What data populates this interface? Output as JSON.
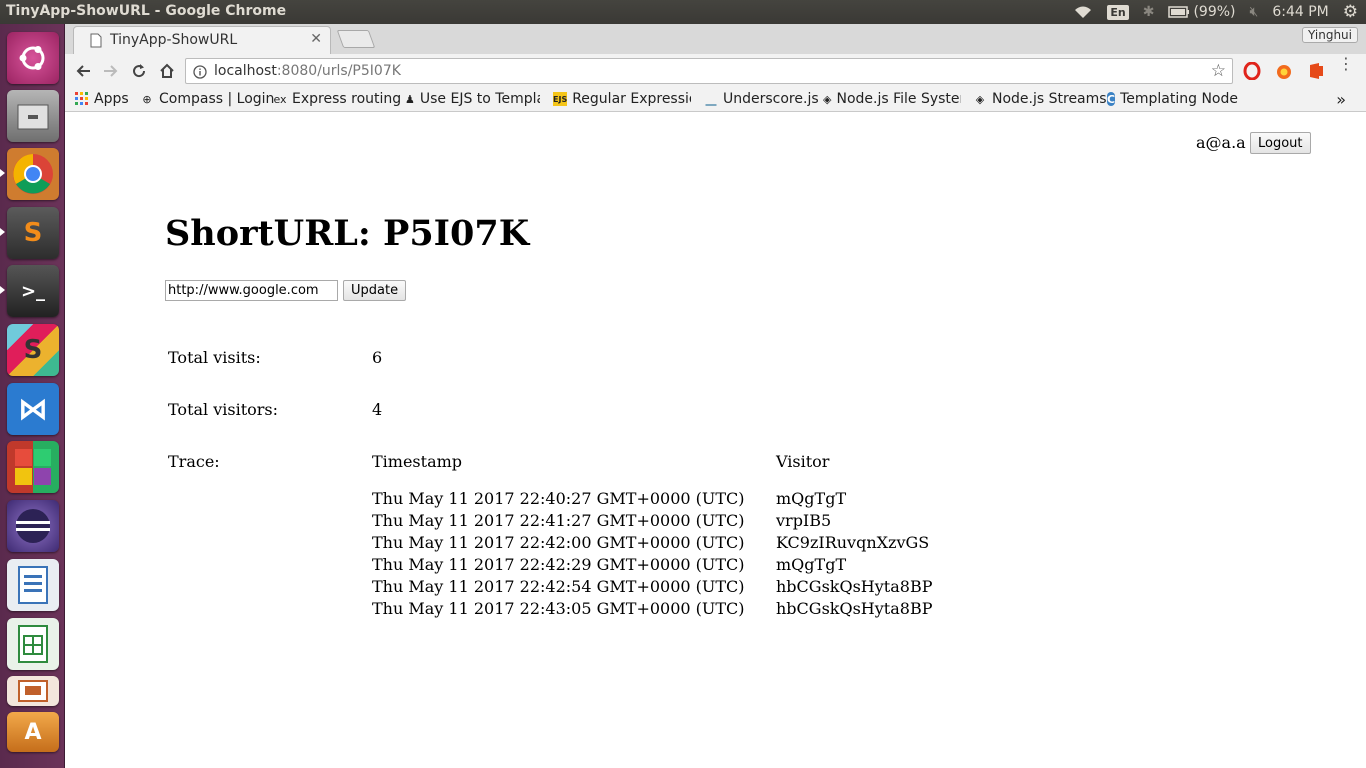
{
  "os": {
    "window_title": "TinyApp-ShowURL - Google Chrome",
    "keyboard": "En",
    "battery": "(99%)",
    "clock": "6:44 PM"
  },
  "browser": {
    "tab_title": "TinyApp-ShowURL",
    "profile": "Yinghui",
    "url_host": "localhost",
    "url_rest": ":8080/urls/P5I07K",
    "bookmarks": [
      {
        "label": "Apps",
        "icon": "apps-grid-icon"
      },
      {
        "label": "Compass | Login",
        "icon": "compass-icon"
      },
      {
        "label": "Express routing",
        "icon": "express-icon"
      },
      {
        "label": "Use EJS to Templa",
        "icon": "ejs-person-icon"
      },
      {
        "label": "Regular Expression",
        "icon": "ejs-icon"
      },
      {
        "label": "Underscore.js",
        "icon": "underscore-icon"
      },
      {
        "label": "Node.js File Syster",
        "icon": "nodejs-icon"
      },
      {
        "label": "Node.js Streams",
        "icon": "nodejs-icon"
      },
      {
        "label": "Templating Node a",
        "icon": "c-logo-icon"
      }
    ]
  },
  "page": {
    "user_email": "a@a.a",
    "logout_label": "Logout",
    "heading": "ShortURL: P5I07K",
    "long_url_value": "http://www.google.com",
    "update_label": "Update",
    "total_visits_label": "Total visits:",
    "total_visits": "6",
    "total_visitors_label": "Total visitors:",
    "total_visitors": "4",
    "trace_label": "Trace:",
    "timestamp_header": "Timestamp",
    "visitor_header": "Visitor",
    "trace": [
      {
        "timestamp": "Thu May 11 2017 22:40:27 GMT+0000 (UTC)",
        "visitor": "mQgTgT"
      },
      {
        "timestamp": "Thu May 11 2017 22:41:27 GMT+0000 (UTC)",
        "visitor": "vrpIB5"
      },
      {
        "timestamp": "Thu May 11 2017 22:42:00 GMT+0000 (UTC)",
        "visitor": "KC9zIRuvqnXzvGS"
      },
      {
        "timestamp": "Thu May 11 2017 22:42:29 GMT+0000 (UTC)",
        "visitor": "mQgTgT"
      },
      {
        "timestamp": "Thu May 11 2017 22:42:54 GMT+0000 (UTC)",
        "visitor": "hbCGskQsHyta8BP"
      },
      {
        "timestamp": "Thu May 11 2017 22:43:05 GMT+0000 (UTC)",
        "visitor": "hbCGskQsHyta8BP"
      }
    ]
  },
  "launcher": [
    {
      "name": "ubuntu-dash-icon",
      "color": "#b8367a"
    },
    {
      "name": "files-icon",
      "color": "#8c8c8c"
    },
    {
      "name": "chrome-icon",
      "color": "#dd4b39"
    },
    {
      "name": "sublime-text-icon",
      "color": "#4b4b4b"
    },
    {
      "name": "terminal-icon",
      "color": "#2c2c2c"
    },
    {
      "name": "slack-icon",
      "color": "#e8e8e8"
    },
    {
      "name": "vscode-icon",
      "color": "#1e6fc4"
    },
    {
      "name": "app-grid-icon",
      "color": "#c0392b"
    },
    {
      "name": "eclipse-icon",
      "color": "#6b4fa0"
    },
    {
      "name": "libreoffice-writer-icon",
      "color": "#3a73b8"
    },
    {
      "name": "libreoffice-calc-icon",
      "color": "#2e8b3e"
    },
    {
      "name": "libreoffice-impress-icon",
      "color": "#c0602b"
    },
    {
      "name": "software-center-icon",
      "color": "#d9822b"
    }
  ]
}
